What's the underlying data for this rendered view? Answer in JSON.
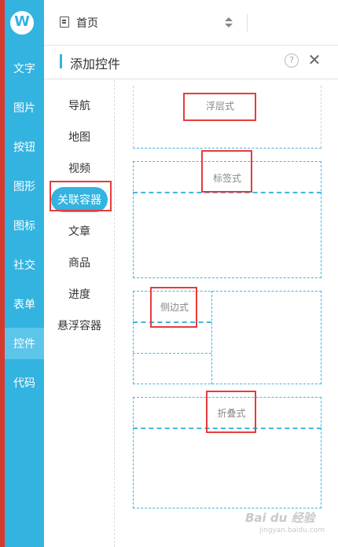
{
  "app": {
    "logo_text": "W",
    "nav_items": [
      {
        "label": "文字",
        "active": false
      },
      {
        "label": "图片",
        "active": false
      },
      {
        "label": "按钮",
        "active": false
      },
      {
        "label": "图形",
        "active": false
      },
      {
        "label": "图标",
        "active": false
      },
      {
        "label": "社交",
        "active": false
      },
      {
        "label": "表单",
        "active": false
      },
      {
        "label": "控件",
        "active": true
      },
      {
        "label": "代码",
        "active": false
      }
    ]
  },
  "topbar": {
    "page_title": "首页"
  },
  "panel": {
    "title": "添加控件",
    "help_glyph": "?",
    "close_glyph": "✕"
  },
  "categories": [
    {
      "label": "导航",
      "active": false
    },
    {
      "label": "地图",
      "active": false
    },
    {
      "label": "视频",
      "active": false
    },
    {
      "label": "关联容器",
      "active": true
    },
    {
      "label": "文章",
      "active": false
    },
    {
      "label": "商品",
      "active": false
    },
    {
      "label": "进度",
      "active": false
    },
    {
      "label": "悬浮容器",
      "active": false
    }
  ],
  "widgets": {
    "floating": "浮层式",
    "tabs": "标签式",
    "sidebar": "侧边式",
    "folding": "折叠式"
  },
  "watermark": {
    "main": "Bai du 经验",
    "sub": "jingyan.baidu.com"
  },
  "colors": {
    "accent": "#33b3e0",
    "highlight": "#e63b3b"
  }
}
